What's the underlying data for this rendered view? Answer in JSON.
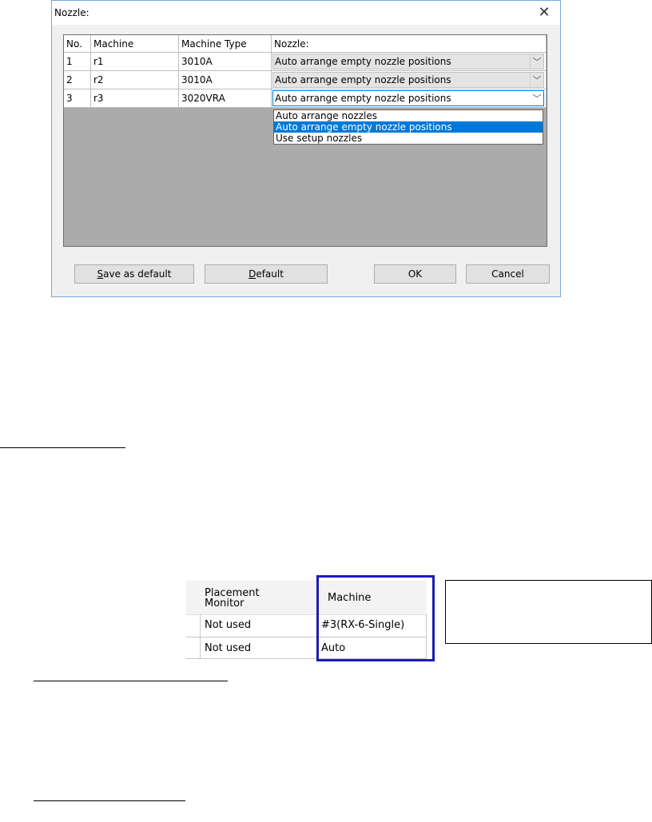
{
  "dialog": {
    "title": "Nozzle:",
    "close_symbol": "✕",
    "columns": [
      "No.",
      "Machine",
      "Machine Type",
      "Nozzle:"
    ],
    "rows": [
      {
        "no": "1",
        "machine": "r1",
        "type": "3010A",
        "nozzle": "Auto arrange empty nozzle positions"
      },
      {
        "no": "2",
        "machine": "r2",
        "type": "3010A",
        "nozzle": "Auto arrange empty nozzle positions"
      },
      {
        "no": "3",
        "machine": "r3",
        "type": "3020VRA",
        "nozzle": "Auto arrange empty nozzle positions"
      }
    ],
    "dropdown_options": [
      "Auto arrange nozzles",
      "Auto arrange empty nozzle positions",
      "Use setup nozzles"
    ],
    "selected_option": "Auto arrange empty nozzle positions",
    "buttons": {
      "save_default_mnemonic": "S",
      "save_default_rest": "ave as default",
      "default_mnemonic": "D",
      "default_rest": "efault",
      "ok": "OK",
      "cancel": "Cancel"
    }
  },
  "snippet": {
    "headers": {
      "placement_line1": "Placement",
      "placement_line2": "Monitor",
      "machine": "Machine"
    },
    "rows": [
      {
        "placement": "Not used",
        "machine": "#3(RX-6-Single)"
      },
      {
        "placement": "Not used",
        "machine": "Auto"
      }
    ]
  },
  "colors": {
    "accent": "#0078d7",
    "highlight_box": "#1c1cb6",
    "grid_background": "#ababab"
  }
}
